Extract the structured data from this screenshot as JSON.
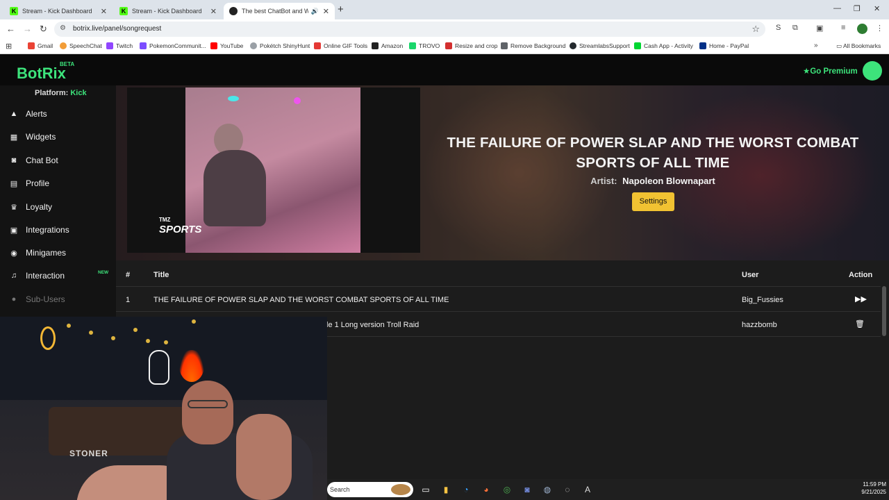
{
  "browser": {
    "tabs": [
      {
        "title": "Stream - Kick Dashboard",
        "favicon": "kick-icon"
      },
      {
        "title": "Stream - Kick Dashboard",
        "favicon": "kick-icon"
      },
      {
        "title": "The best ChatBot and Wid",
        "favicon": "botrix-icon",
        "active": true
      }
    ],
    "url": "botrix.live/panel/songrequest",
    "bookmarks": [
      {
        "label": "Gmail",
        "color": "#ea4335"
      },
      {
        "label": "SpeechChat",
        "color": "#f29d38"
      },
      {
        "label": "Twitch",
        "color": "#9146ff"
      },
      {
        "label": "PokemonCommunit...",
        "color": "#7c4dff"
      },
      {
        "label": "YouTube",
        "color": "#ff0000"
      },
      {
        "label": "Pokétch ShinyHunt",
        "color": "#9aa0a6"
      },
      {
        "label": "Online GIF Tools",
        "color": "#e53935"
      },
      {
        "label": "Amazon",
        "color": "#222222"
      },
      {
        "label": "TROVO",
        "color": "#19d66b"
      },
      {
        "label": "Resize and crop",
        "color": "#d32f2f"
      },
      {
        "label": "Remove Background",
        "color": "#5f6368"
      },
      {
        "label": "StreamlabsSupport",
        "color": "#24292e"
      },
      {
        "label": "Cash App - Activity",
        "color": "#00d632"
      },
      {
        "label": "Home - PayPal",
        "color": "#003087"
      }
    ],
    "all_bookmarks": "All Bookmarks"
  },
  "app": {
    "logo": "BotRix",
    "beta": "BETA",
    "go_premium": "Go Premium",
    "platform_label": "Platform:",
    "platform_value": "Kick",
    "nav": [
      {
        "label": "Alerts",
        "icon": "warning-icon"
      },
      {
        "label": "Widgets",
        "icon": "widgets-icon"
      },
      {
        "label": "Chat Bot",
        "icon": "robot-icon"
      },
      {
        "label": "Profile",
        "icon": "profile-card-icon"
      },
      {
        "label": "Loyalty",
        "icon": "trophy-icon"
      },
      {
        "label": "Integrations",
        "icon": "integrations-icon"
      },
      {
        "label": "Minigames",
        "icon": "gamepad-icon"
      },
      {
        "label": "Interaction",
        "icon": "music-icon"
      },
      {
        "label": "Sub-Users",
        "icon": "users-icon"
      }
    ],
    "nav_badge": "NEW",
    "now_playing": {
      "title": "THE FAILURE OF POWER SLAP AND THE WORST COMBAT SPORTS OF ALL TIME",
      "artist_label": "Artist:",
      "artist": "Napoleon Blownapart",
      "settings_button": "Settings",
      "video_brand_small": "TMZ",
      "video_brand_large": "SPORTS"
    },
    "queue": {
      "headers": [
        "#",
        "Title",
        "User",
        "Action"
      ],
      "rows": [
        {
          "num": "1",
          "title": "THE FAILURE OF POWER SLAP AND THE WORST COMBAT SPORTS OF ALL TIME",
          "user": "Big_Fussies",
          "action": "play-next-icon"
        },
        {
          "num": "",
          "title": "le 1 Long version Troll Raid",
          "user": "hazzbomb",
          "action": "trash-icon"
        }
      ]
    }
  },
  "webcam": {
    "sign_text": "STONER"
  },
  "taskbar": {
    "search_placeholder": "Search",
    "time": "11:59 PM",
    "date": "9/21/2025"
  },
  "colors": {
    "brand_green": "#3de37b",
    "settings_yellow": "#f1c232",
    "panel_bg": "#1c1c1c"
  }
}
